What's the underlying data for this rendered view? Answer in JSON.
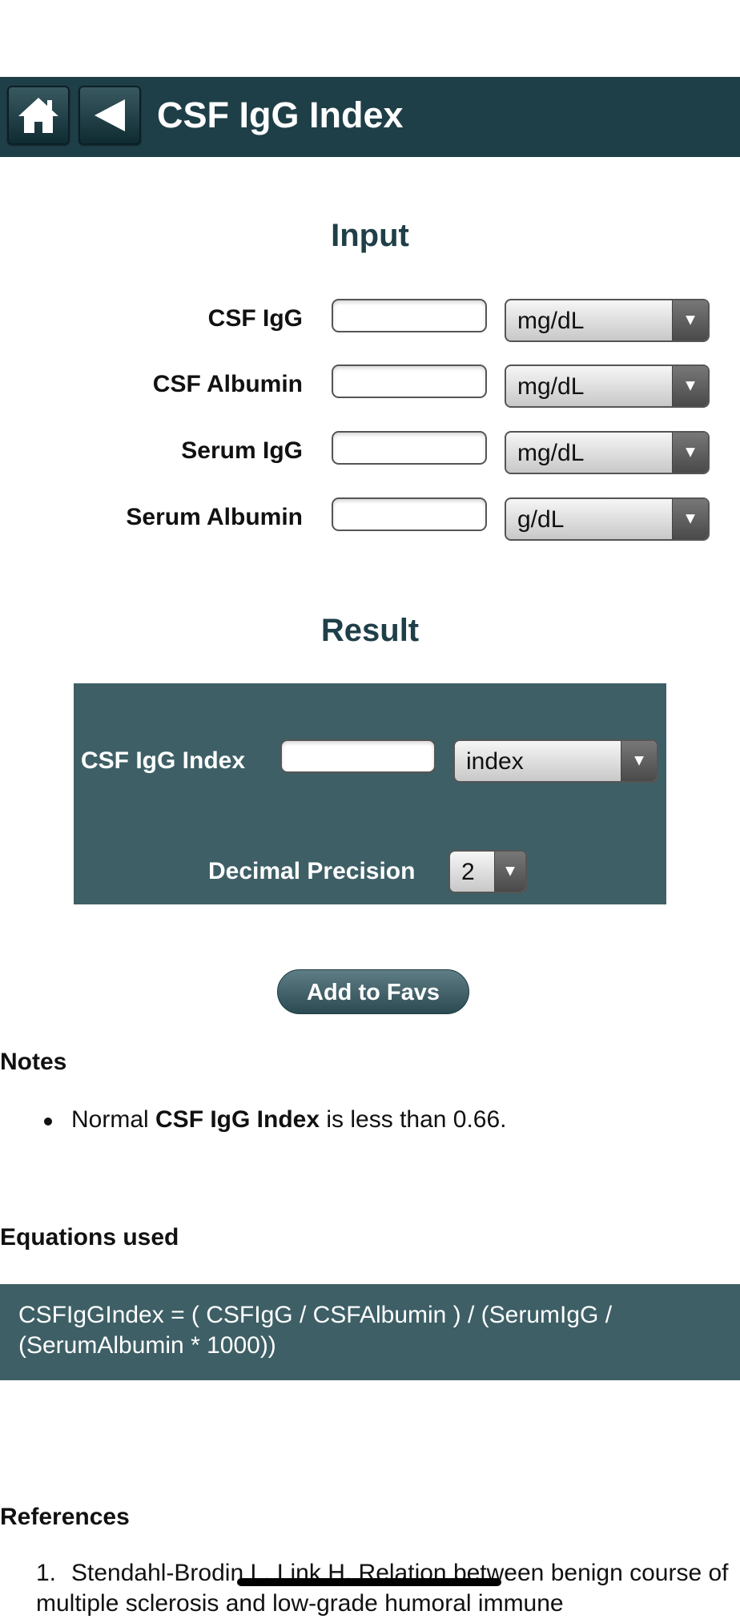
{
  "header": {
    "title": "CSF IgG Index"
  },
  "input": {
    "title": "Input",
    "rows": [
      {
        "label": "CSF IgG",
        "value": "",
        "unit": "mg/dL"
      },
      {
        "label": "CSF Albumin",
        "value": "",
        "unit": "mg/dL"
      },
      {
        "label": "Serum IgG",
        "value": "",
        "unit": "mg/dL"
      },
      {
        "label": "Serum Albumin",
        "value": "",
        "unit": "g/dL"
      }
    ]
  },
  "result": {
    "title": "Result",
    "label": "CSF IgG Index",
    "value": "",
    "unit": "index",
    "precision_label": "Decimal Precision",
    "precision_value": "2"
  },
  "actions": {
    "add_favs": "Add to Favs"
  },
  "notes": {
    "title": "Notes",
    "prefix": "Normal ",
    "bold": "CSF IgG Index",
    "suffix": " is less than 0.66."
  },
  "equations": {
    "title": "Equations used",
    "text": "CSFIgGIndex = ( CSFIgG / CSFAlbumin ) / (SerumIgG / (SerumAlbumin * 1000))"
  },
  "references": {
    "title": "References",
    "items": [
      {
        "num": "1.",
        "text": "Stendahl-Brodin L, Link H. Relation between benign course of multiple sclerosis and low-grade humoral immune"
      }
    ]
  },
  "icons": {
    "home": "home-icon",
    "back": "back-arrow-icon",
    "dropdown": "chevron-down-icon"
  }
}
